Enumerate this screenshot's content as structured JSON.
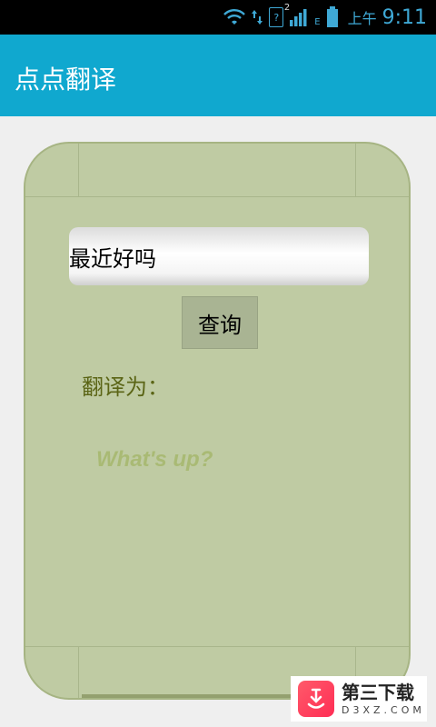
{
  "status_bar": {
    "sim_number": "2",
    "sim_label": "?",
    "network_type": "E",
    "ampm": "上午",
    "time": "9:11",
    "icons": [
      "wifi-icon",
      "data-arrows-icon",
      "sim-icon",
      "signal-icon",
      "battery-icon"
    ]
  },
  "app": {
    "title": "点点翻译"
  },
  "translator": {
    "input_value": "最近好吗",
    "button_label": "查询",
    "result_label": "翻译为：",
    "result_text": "What's up?"
  },
  "watermark": {
    "cn": "第三下载",
    "en": "D3XZ.COM"
  },
  "colors": {
    "action_bar": "#10a8cf",
    "card_bg": "#bfcba3",
    "result_label": "#5b6516",
    "result_text": "#a9ba74"
  }
}
